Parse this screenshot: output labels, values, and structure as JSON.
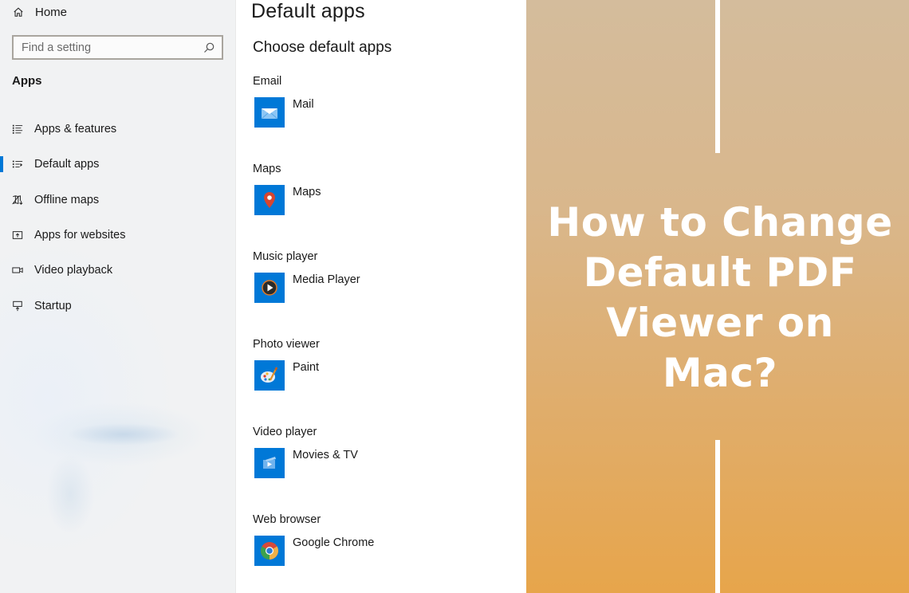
{
  "sidebar": {
    "home": {
      "label": "Home",
      "icon": "home-icon"
    },
    "search": {
      "placeholder": "Find a setting",
      "value": "",
      "icon": "search-icon"
    },
    "section_label": "Apps",
    "items": [
      {
        "label": "Apps & features",
        "icon": "apps-features-icon",
        "active": false
      },
      {
        "label": "Default apps",
        "icon": "default-apps-icon",
        "active": true
      },
      {
        "label": "Offline maps",
        "icon": "offline-maps-icon",
        "active": false
      },
      {
        "label": "Apps for websites",
        "icon": "apps-for-websites-icon",
        "active": false
      },
      {
        "label": "Video playback",
        "icon": "video-playback-icon",
        "active": false
      },
      {
        "label": "Startup",
        "icon": "startup-icon",
        "active": false
      }
    ],
    "accent_color": "#0078d7"
  },
  "main": {
    "title": "Default apps",
    "subtitle": "Choose default apps",
    "groups": [
      {
        "label": "Email",
        "app": "Mail",
        "icon": "mail-icon"
      },
      {
        "label": "Maps",
        "app": "Maps",
        "icon": "maps-pin-icon"
      },
      {
        "label": "Music player",
        "app": "Media Player",
        "icon": "media-player-icon"
      },
      {
        "label": "Photo viewer",
        "app": "Paint",
        "icon": "paint-palette-icon"
      },
      {
        "label": "Video player",
        "app": "Movies & TV",
        "icon": "movies-tv-icon"
      },
      {
        "label": "Web browser",
        "app": "Google Chrome",
        "icon": "chrome-icon"
      }
    ],
    "tile_color": "#0078d7"
  },
  "promo": {
    "title_lines": [
      "How to Change",
      "Default PDF",
      "Viewer on",
      "Mac?"
    ],
    "gradient_top": "#d4bc9c",
    "gradient_bottom": "#e7a54b",
    "line_color": "#ffffff"
  }
}
